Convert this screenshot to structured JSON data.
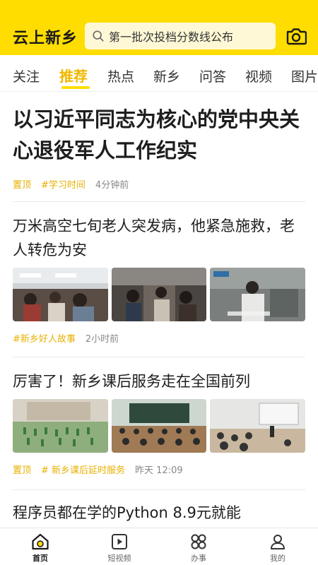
{
  "header": {
    "logo": "云上新乡",
    "search_text": "第一批次投档分数线公布",
    "accent": "#FFDD00"
  },
  "tabs": [
    {
      "label": "关注"
    },
    {
      "label": "推荐"
    },
    {
      "label": "热点"
    },
    {
      "label": "新乡"
    },
    {
      "label": "问答"
    },
    {
      "label": "视频"
    },
    {
      "label": "图片"
    }
  ],
  "active_tab": "推荐",
  "feed": [
    {
      "title": "以习近平同志为核心的党中央关心退役军人工作纪实",
      "pin": "置顶",
      "tag": "#学习时间",
      "time": "4分钟前"
    },
    {
      "title": "万米高空七旬老人突发病，他紧急施救，老人转危为安",
      "tag": "#新乡好人故事",
      "time": "2小时前",
      "images": [
        "airplane-cabin-photo",
        "airplane-aisle-photo",
        "news-video-still-photo"
      ]
    },
    {
      "title": "厉害了！新乡课后服务走在全国前列",
      "pin": "置顶",
      "tag": "# 新乡课后延时服务",
      "time": "昨天 12:09",
      "images": [
        "schoolyard-exercise-photo",
        "classroom-photo",
        "lecture-hall-photo"
      ]
    },
    {
      "title": "程序员都在学的Python 8.9元就能"
    }
  ],
  "bottom_nav": [
    {
      "label": "首页",
      "icon": "home-icon"
    },
    {
      "label": "短视频",
      "icon": "play-icon"
    },
    {
      "label": "办事",
      "icon": "services-grid-icon"
    },
    {
      "label": "我的",
      "icon": "profile-icon"
    }
  ]
}
